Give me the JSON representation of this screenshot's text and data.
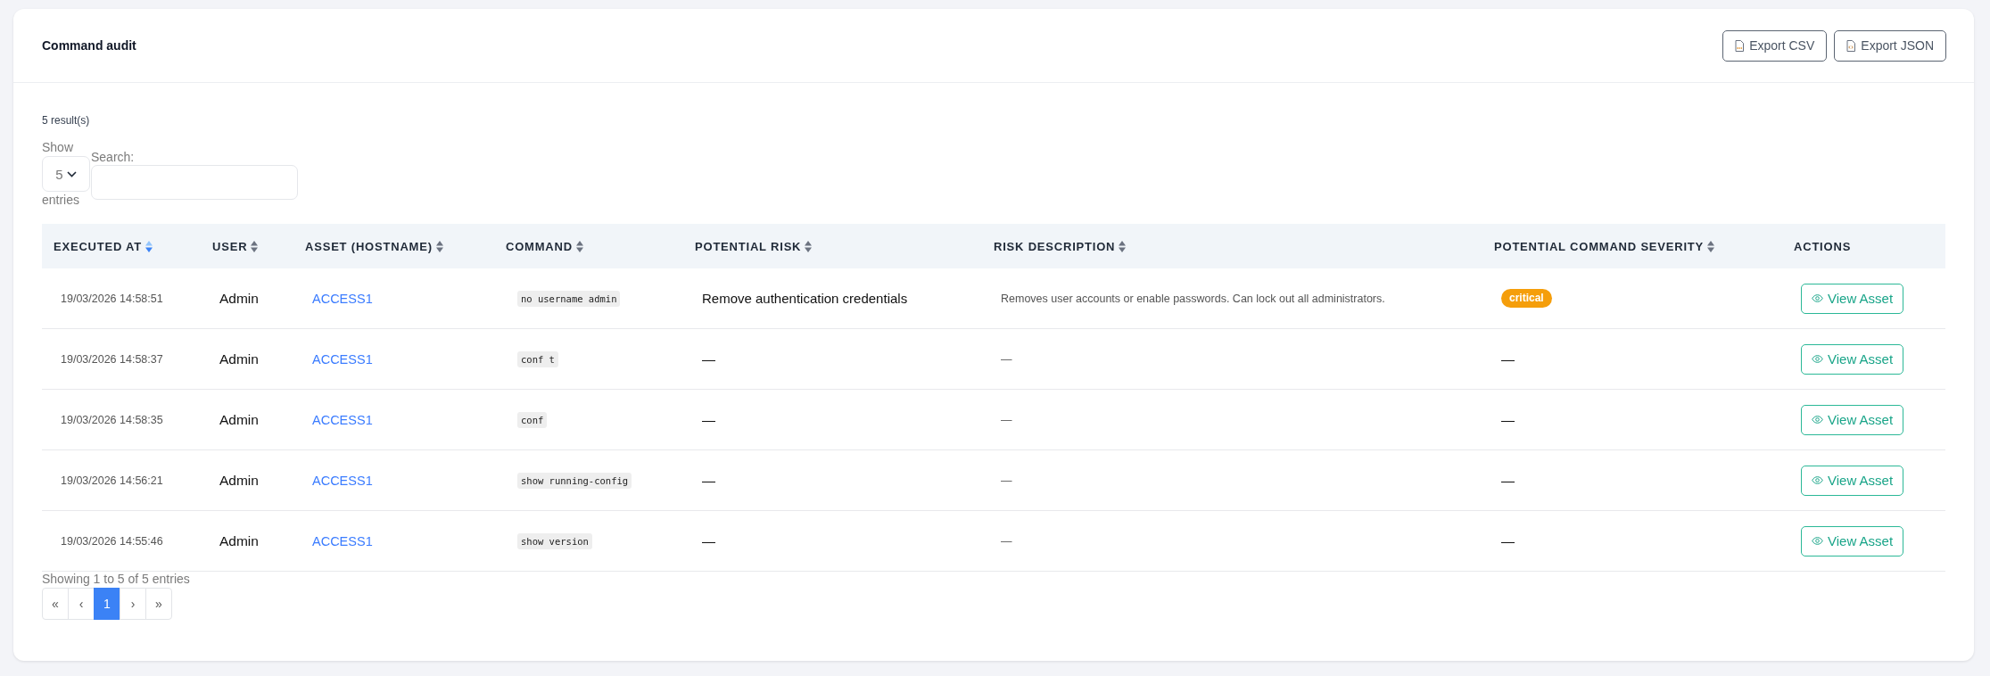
{
  "card": {
    "title": "Command audit",
    "export_buttons": [
      {
        "label": "Export CSV",
        "kind": "csv"
      },
      {
        "label": "Export JSON",
        "kind": "json"
      }
    ]
  },
  "results_count": "5 result(s)",
  "page_length": {
    "label_before": "Show",
    "value": "5",
    "label_after": "entries"
  },
  "search": {
    "label": "Search:"
  },
  "table": {
    "columns": [
      {
        "label": "EXECUTED AT",
        "sortable": true,
        "sorted": true
      },
      {
        "label": "USER",
        "sortable": true,
        "sorted": false
      },
      {
        "label": "ASSET (HOSTNAME)",
        "sortable": true,
        "sorted": false
      },
      {
        "label": "COMMAND",
        "sortable": true,
        "sorted": false
      },
      {
        "label": "POTENTIAL RISK",
        "sortable": true,
        "sorted": false
      },
      {
        "label": "RISK DESCRIPTION",
        "sortable": true,
        "sorted": false
      },
      {
        "label": "POTENTIAL COMMAND SEVERITY",
        "sortable": true,
        "sorted": false
      },
      {
        "label": "ACTIONS",
        "sortable": false,
        "sorted": false
      }
    ],
    "rows": [
      {
        "executed_at": "19/03/2026 14:58:51",
        "user": "Admin",
        "asset": "ACCESS1",
        "command": "no username admin",
        "potential_risk": "Remove authentication credentials",
        "risk_description": "Removes user accounts or enable passwords. Can lock out all administrators.",
        "severity": {
          "kind": "badge",
          "text": "critical"
        },
        "action": "View Asset"
      },
      {
        "executed_at": "19/03/2026 14:58:37",
        "user": "Admin",
        "asset": "ACCESS1",
        "command": "conf t",
        "potential_risk": "—",
        "risk_description": "—",
        "severity": {
          "kind": "text",
          "text": "—"
        },
        "action": "View Asset"
      },
      {
        "executed_at": "19/03/2026 14:58:35",
        "user": "Admin",
        "asset": "ACCESS1",
        "command": "conf",
        "potential_risk": "—",
        "risk_description": "—",
        "severity": {
          "kind": "text",
          "text": "—"
        },
        "action": "View Asset"
      },
      {
        "executed_at": "19/03/2026 14:56:21",
        "user": "Admin",
        "asset": "ACCESS1",
        "command": "show running-config",
        "potential_risk": "—",
        "risk_description": "—",
        "severity": {
          "kind": "text",
          "text": "—"
        },
        "action": "View Asset"
      },
      {
        "executed_at": "19/03/2026 14:55:46",
        "user": "Admin",
        "asset": "ACCESS1",
        "command": "show version",
        "potential_risk": "—",
        "risk_description": "—",
        "severity": {
          "kind": "text",
          "text": "—"
        },
        "action": "View Asset"
      }
    ]
  },
  "footer": {
    "info": "Showing 1 to 5 of 5 entries",
    "pagination": [
      {
        "label": "«",
        "selected": false
      },
      {
        "label": "‹",
        "selected": false
      },
      {
        "label": "1",
        "selected": true
      },
      {
        "label": "›",
        "selected": false
      },
      {
        "label": "»",
        "selected": false
      }
    ]
  }
}
